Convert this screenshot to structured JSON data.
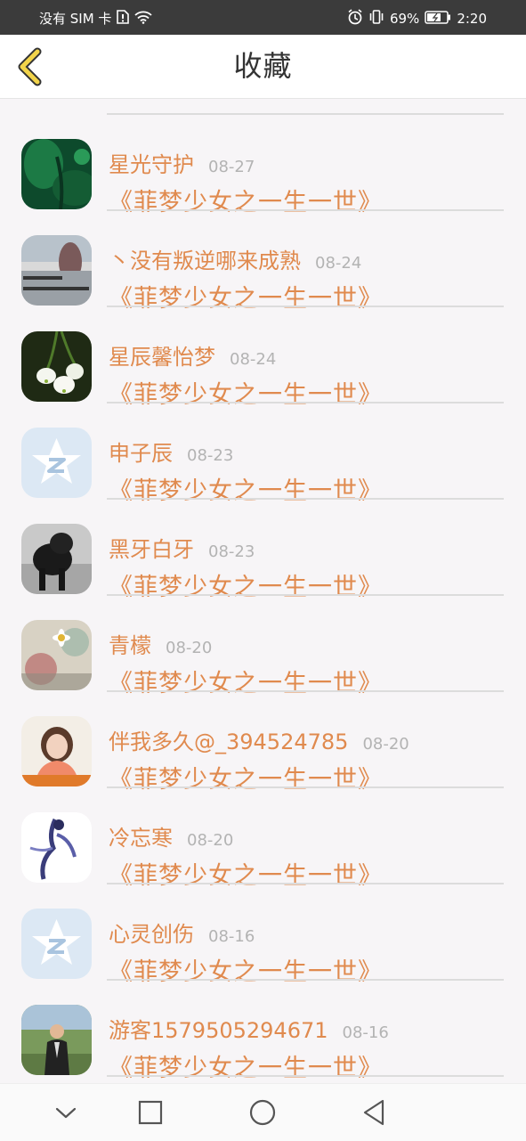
{
  "status_bar": {
    "carrier": "没有 SIM 卡",
    "battery_percent": "69%",
    "time": "2:20"
  },
  "header": {
    "title": "收藏"
  },
  "items": [
    {
      "name": "星光守护",
      "date": "08-27",
      "book": "《菲梦少女之一生一世》",
      "avatar": "lotus-leaf"
    },
    {
      "name": "丶没有叛逆哪来成熟",
      "date": "08-24",
      "book": "《菲梦少女之一生一世》",
      "avatar": "photo-with-text"
    },
    {
      "name": "星辰馨怡梦",
      "date": "08-24",
      "book": "《菲梦少女之一生一世》",
      "avatar": "white-flowers"
    },
    {
      "name": "申子辰",
      "date": "08-23",
      "book": "《菲梦少女之一生一世》",
      "avatar": "default-qzone"
    },
    {
      "name": "黑牙白牙",
      "date": "08-23",
      "book": "《菲梦少女之一生一世》",
      "avatar": "black-dog"
    },
    {
      "name": "青檬",
      "date": "08-20",
      "book": "《菲梦少女之一生一世》",
      "avatar": "daisy-painting"
    },
    {
      "name": "伴我多久@_394524785",
      "date": "08-20",
      "book": "《菲梦少女之一生一世》",
      "avatar": "girl-portrait"
    },
    {
      "name": "冷忘寒",
      "date": "08-20",
      "book": "《菲梦少女之一生一世》",
      "avatar": "ink-figure"
    },
    {
      "name": "心灵创伤",
      "date": "08-16",
      "book": "《菲梦少女之一生一世》",
      "avatar": "default-qzone"
    },
    {
      "name": "游客1579505294671",
      "date": "08-16",
      "book": "《菲梦少女之一生一世》",
      "avatar": "man-field"
    }
  ]
}
